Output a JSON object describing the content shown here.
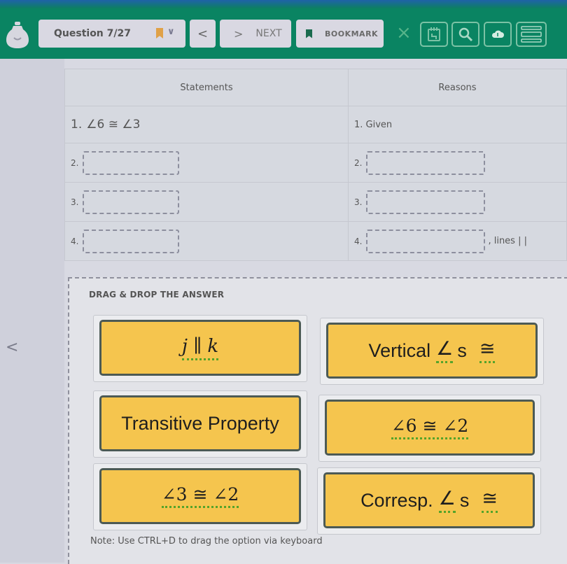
{
  "toolbar": {
    "question_label": "Question 7/27",
    "prev_label": "<",
    "next_arrow": ">",
    "next_label": "NEXT",
    "bookmark_label": "BOOKMARK",
    "close_glyph": "×",
    "icons": [
      "logo-icon",
      "bookmark-icon",
      "chevron-down-icon",
      "notepad-icon",
      "search-icon",
      "cloud-icon",
      "menu-icon"
    ],
    "colors": {
      "bar": "#0a8462",
      "bookmark_flag": "#e0a147",
      "button_bg": "#d9d8e2"
    }
  },
  "nav": {
    "back_glyph": "<"
  },
  "table": {
    "headers": {
      "statements": "Statements",
      "reasons": "Reasons"
    },
    "rows": [
      {
        "num": "1.",
        "statement": "∠6 ≅ ∠3",
        "reason": "1. Given"
      },
      {
        "num": "2.",
        "statement": "",
        "reason_num": "2.",
        "reason": ""
      },
      {
        "num": "3.",
        "statement": "",
        "reason_num": "3.",
        "reason": ""
      },
      {
        "num": "4.",
        "statement": "",
        "reason_num": "4.",
        "reason": "",
        "reason_suffix": ", lines | |"
      }
    ]
  },
  "answers": {
    "title": "DRAG & DROP THE ANSWER",
    "options": [
      {
        "label": "j ∥ k"
      },
      {
        "label": "Vertical",
        "angle": "∠",
        "s": "s",
        "cong": "≅"
      },
      {
        "label": "Transitive Property"
      },
      {
        "label": "∠6 ≅ ∠2"
      },
      {
        "label": "∠3 ≅ ∠2"
      },
      {
        "label": "Corresp.",
        "angle": "∠",
        "s": "s",
        "cong": "≅"
      }
    ],
    "note": "Note: Use CTRL+D to drag the option via keyboard",
    "colors": {
      "tile": "#f5c54e",
      "tile_border": "#4c5a55",
      "spell_underline": "#55a32a"
    }
  }
}
